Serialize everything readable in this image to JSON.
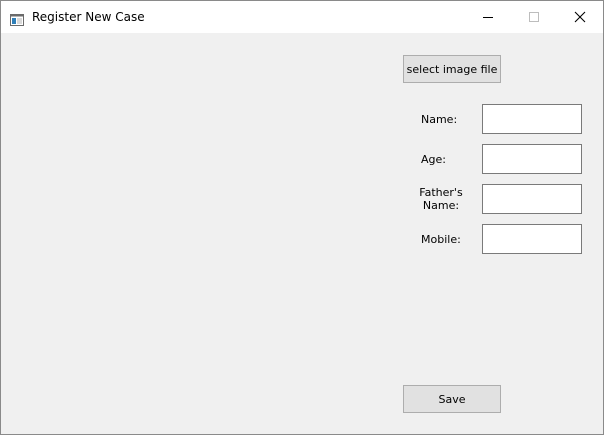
{
  "window": {
    "title": "Register New Case",
    "icon": "app-window-icon",
    "controls": {
      "minimize_icon": "minimize-icon",
      "maximize_icon": "maximize-icon",
      "close_icon": "close-icon"
    }
  },
  "form": {
    "select_image_label": "select image file",
    "fields": {
      "name": {
        "label": "Name:",
        "value": "",
        "placeholder": ""
      },
      "age": {
        "label": "Age:",
        "value": "",
        "placeholder": ""
      },
      "father_name": {
        "label_line1": "Father's",
        "label_line2": "Name:",
        "value": "",
        "placeholder": ""
      },
      "mobile": {
        "label": "Mobile:",
        "value": "",
        "placeholder": ""
      }
    },
    "save_label": "Save"
  },
  "colors": {
    "window_bg": "#f0f0f0",
    "titlebar_bg": "#ffffff",
    "button_bg": "#e1e1e1",
    "button_border": "#adadad",
    "field_border": "#7a7a7a"
  }
}
